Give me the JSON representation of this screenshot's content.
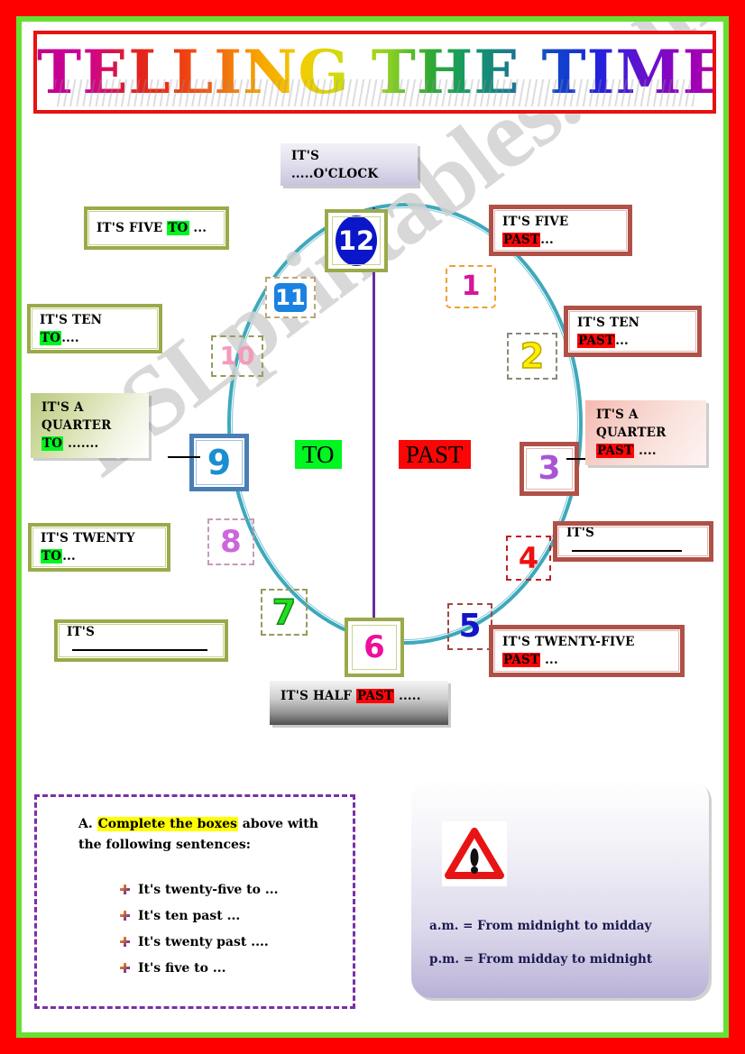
{
  "title": "TELLING THE TIME",
  "watermark": "ESLprintables.com",
  "clock": {
    "center_left_word": "TO",
    "center_right_word": "PAST",
    "numbers": [
      {
        "n": "12"
      },
      {
        "n": "1"
      },
      {
        "n": "2"
      },
      {
        "n": "3"
      },
      {
        "n": "4"
      },
      {
        "n": "5"
      },
      {
        "n": "6"
      },
      {
        "n": "7"
      },
      {
        "n": "8"
      },
      {
        "n": "9"
      },
      {
        "n": "10"
      },
      {
        "n": "11"
      }
    ]
  },
  "labels": {
    "oclock": {
      "line1": "IT'S .....O'CLOCK"
    },
    "five_to": {
      "line1": "IT'S FIVE ",
      "hi": "TO",
      "tail": " ..."
    },
    "ten_to": {
      "line1": "IT'S TEN",
      "hi": "TO",
      "tail": "...."
    },
    "quarter_to": {
      "line1": "IT'S A",
      "line2": "QUARTER",
      "hi": "TO",
      "tail": " ......."
    },
    "twenty_to": {
      "line1": "IT'S TWENTY",
      "hi": "TO",
      "tail": "..."
    },
    "blank_left": {
      "line1": "IT'S"
    },
    "five_past": {
      "line1": "IT'S FIVE",
      "hi": "PAST",
      "tail": "..."
    },
    "ten_past": {
      "line1": "IT'S TEN",
      "hi": "PAST",
      "tail": "..."
    },
    "quarter_past": {
      "line1": "IT'S A",
      "line2": "QUARTER",
      "hi": "PAST",
      "tail": " ...."
    },
    "blank_right": {
      "line1": "IT'S"
    },
    "twentyfive_past": {
      "line1": "IT'S TWENTY-FIVE",
      "hi": "PAST",
      "tail": " ..."
    },
    "half_past": {
      "pre": "IT'S HALF ",
      "hi": "PAST",
      "tail": " ....."
    }
  },
  "exercise": {
    "letter": "A.",
    "highlight": "Complete the boxes",
    "rest": " above with",
    "line2": "the following sentences:",
    "items": [
      "It's twenty-five to ...",
      "It's ten past ...",
      "It's twenty past ....",
      "It's five to ..."
    ]
  },
  "ampm": {
    "icon": "warning-triangle-icon",
    "am": "a.m. = From midnight to midday",
    "pm": "p.m. = From midday to midnight"
  }
}
